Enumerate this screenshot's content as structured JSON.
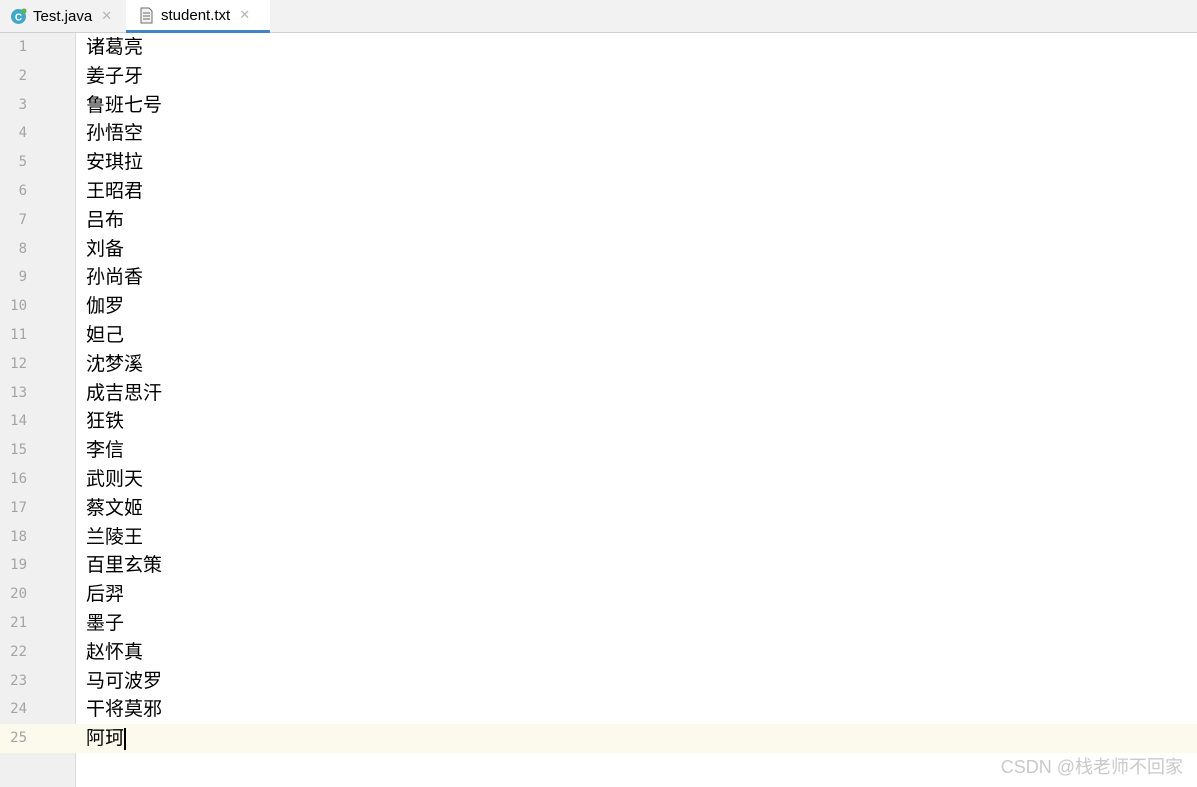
{
  "tabs": [
    {
      "label": "Test.java",
      "icon": "java-class-icon",
      "active": false
    },
    {
      "label": "student.txt",
      "icon": "text-file-icon",
      "active": true
    }
  ],
  "tab_close_glyph": "✕",
  "lines": [
    "诸葛亮",
    "姜子牙",
    "鲁班七号",
    "孙悟空",
    "安琪拉",
    "王昭君",
    "吕布",
    "刘备",
    "孙尚香",
    "伽罗",
    "妲己",
    "沈梦溪",
    "成吉思汗",
    "狂铁",
    "李信",
    "武则天",
    "蔡文姬",
    "兰陵王",
    "百里玄策",
    "后羿",
    "墨子",
    "赵怀真",
    "马可波罗",
    "干将莫邪",
    "阿珂"
  ],
  "current_line": 25,
  "colors": {
    "active_tab_underline": "#4083c9",
    "current_line_highlight": "#fcfaed",
    "line_number": "#a4a4a4"
  },
  "watermark": "CSDN @栈老师不回家"
}
